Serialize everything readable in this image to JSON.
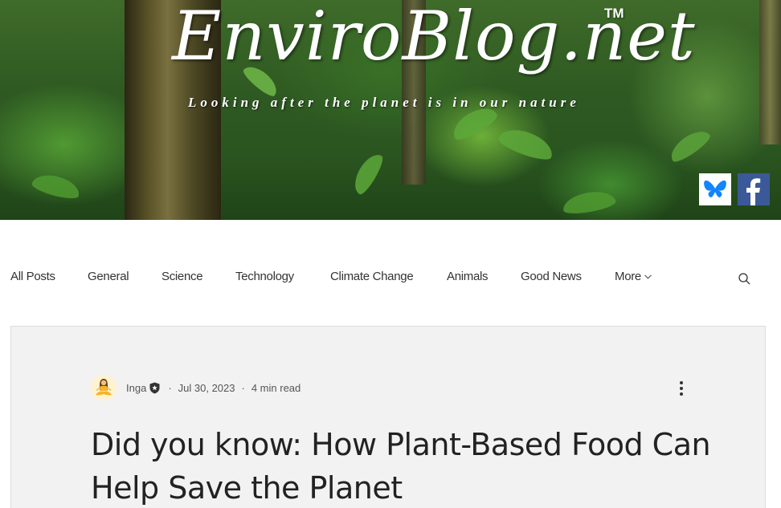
{
  "header": {
    "logo_text": "EnviroBlog.net",
    "trademark": "TM",
    "tagline": "Looking after the planet is in our nature",
    "social": [
      {
        "name": "Bluesky",
        "icon": "butterfly-icon",
        "color": "#1185fe"
      },
      {
        "name": "Facebook",
        "icon": "facebook-f-icon",
        "color": "#3b5998"
      }
    ]
  },
  "nav": {
    "items": [
      {
        "label": "All Posts"
      },
      {
        "label": "General"
      },
      {
        "label": "Science"
      },
      {
        "label": "Technology"
      },
      {
        "label": "Climate Change"
      },
      {
        "label": "Animals"
      },
      {
        "label": "Good News"
      }
    ],
    "more_label": "More",
    "more_icon": "chevron-down-icon",
    "search_icon": "search-icon"
  },
  "post": {
    "author": "Inga",
    "author_badge_icon": "admin-badge-icon",
    "separator": "·",
    "date": "Jul 30, 2023",
    "read_time": "4 min read",
    "menu_icon": "more-vertical-icon",
    "title": "Did you know: How Plant-Based Food Can Help Save the Planet"
  },
  "colors": {
    "nav_text": "#333333",
    "card_bg": "#f2f2f2",
    "title_text": "#222222",
    "facebook_blue": "#3b5998",
    "bluesky_blue": "#1185fe"
  }
}
